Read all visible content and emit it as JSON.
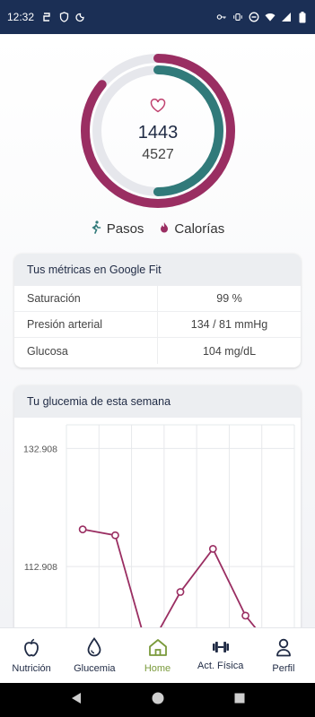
{
  "status_bar": {
    "time": "12:32"
  },
  "summary": {
    "steps_value": "1443",
    "calories_value": "4527",
    "ring_fraction": {
      "steps": 0.5,
      "calories": 0.86
    }
  },
  "legend": {
    "steps_label": "Pasos",
    "calories_label": "Calorías"
  },
  "metrics_card": {
    "title": "Tus métricas en Google Fit",
    "rows": [
      {
        "label": "Saturación",
        "value": "99 %"
      },
      {
        "label": "Presión arterial",
        "value": "134 / 81 mmHg"
      },
      {
        "label": "Glucosa",
        "value": "104 mg/dL"
      }
    ]
  },
  "glucose_card": {
    "title": "Tu glucemia de esta semana"
  },
  "chart_data": {
    "type": "line",
    "title": "Tu glucemia de esta semana",
    "ytick_labels": [
      "132.908",
      "112.908"
    ],
    "ylim": [
      92.6,
      136.9
    ],
    "series": [
      {
        "values": [
          119.2,
          118.2,
          98.7,
          108.6,
          115.9,
          104.6,
          97.8
        ]
      }
    ],
    "grid": true
  },
  "bottom_nav": {
    "items": [
      {
        "label": "Nutrición",
        "icon": "apple-icon"
      },
      {
        "label": "Glucemia",
        "icon": "drop-icon"
      },
      {
        "label": "Home",
        "icon": "home-icon"
      },
      {
        "label": "Act. Física",
        "icon": "dumbbell-icon"
      },
      {
        "label": "Perfil",
        "icon": "person-icon"
      }
    ]
  },
  "colors": {
    "steps": "#317a7a",
    "calories": "#9a2e62",
    "ring_track": "#e6e7ec",
    "accent": "#7a9a3b"
  }
}
